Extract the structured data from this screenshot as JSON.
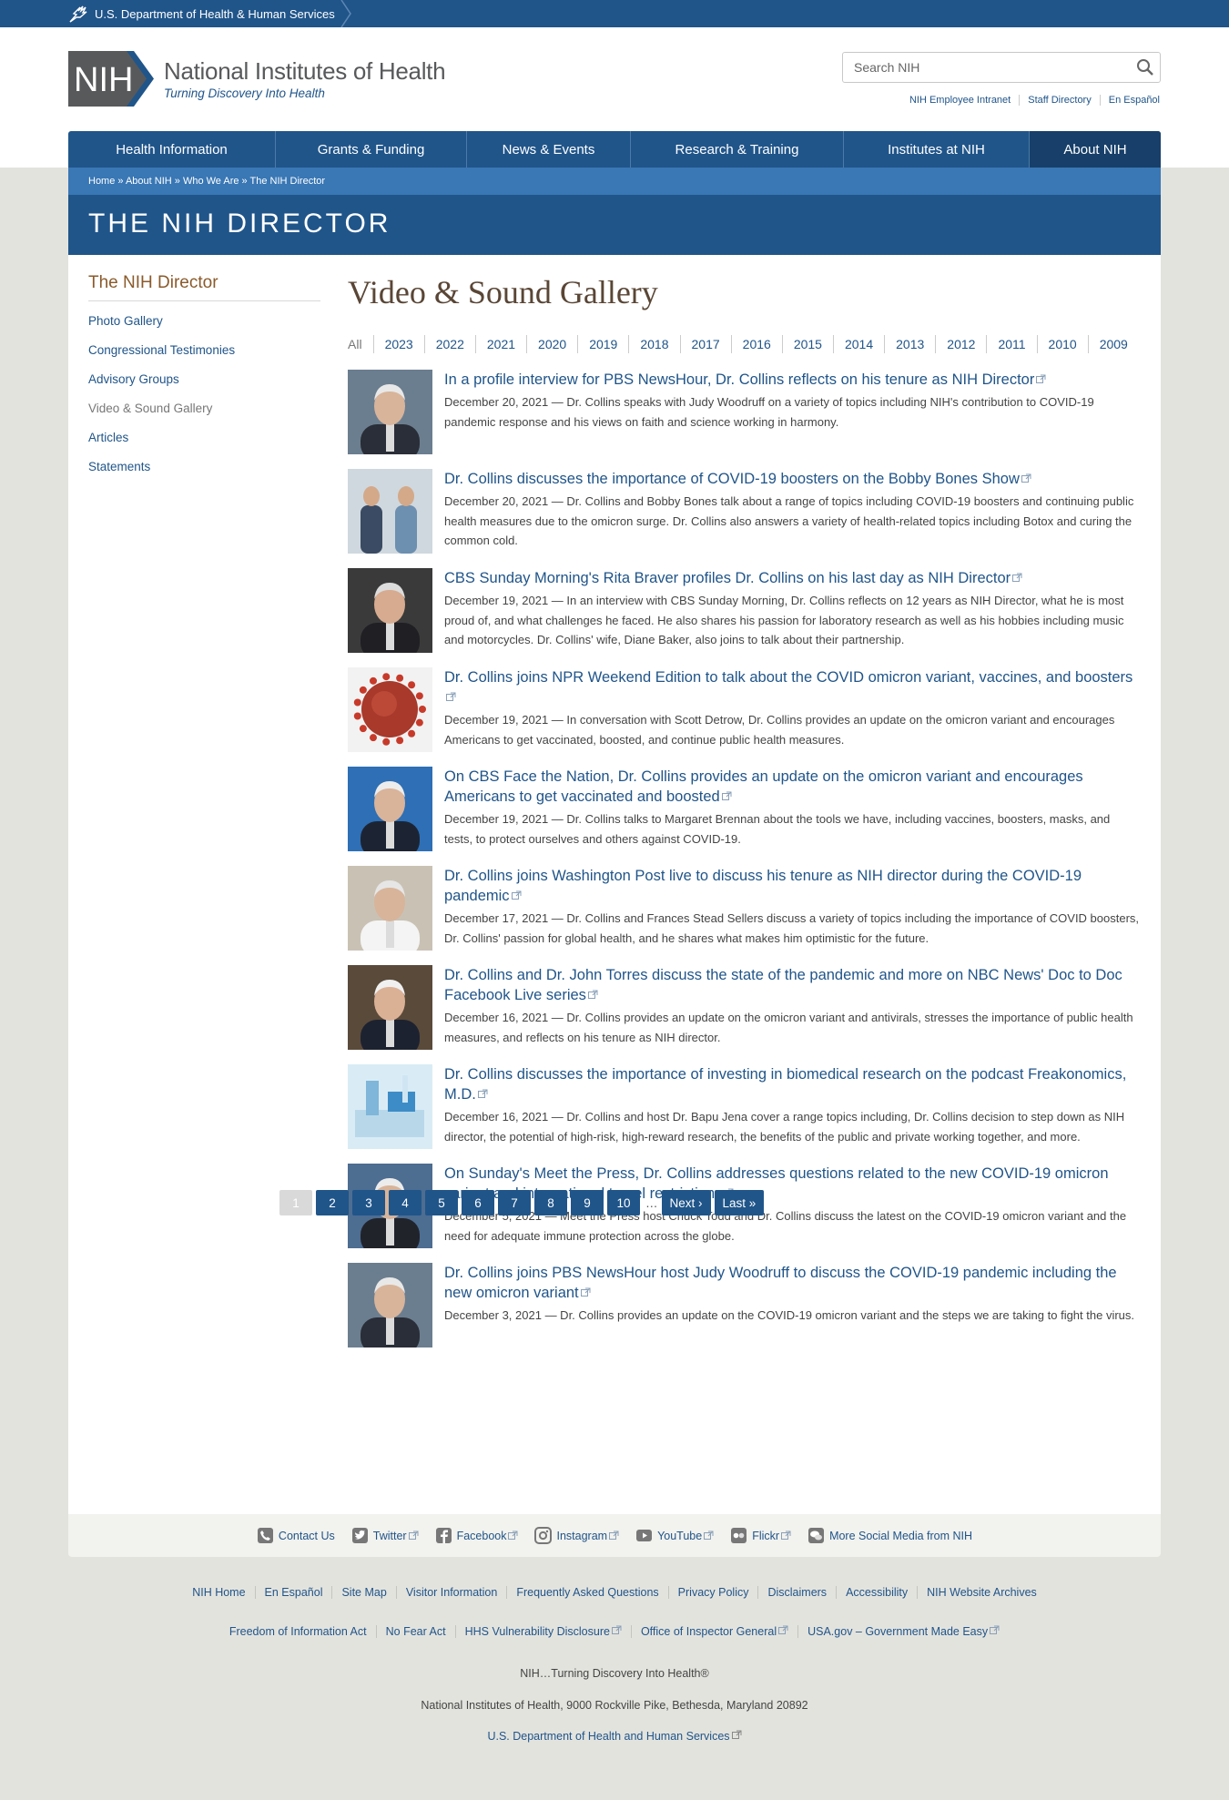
{
  "hhs_bar": {
    "label": "U.S. Department of Health & Human Services"
  },
  "header": {
    "logo_mark": "NIH",
    "logo_title": "National Institutes of Health",
    "logo_tagline": "Turning Discovery Into Health",
    "search_placeholder": "Search NIH",
    "util_links": [
      "NIH Employee Intranet",
      "Staff Directory",
      "En Español"
    ]
  },
  "nav": [
    {
      "label": "Health Information"
    },
    {
      "label": "Grants & Funding"
    },
    {
      "label": "News & Events"
    },
    {
      "label": "Research & Training"
    },
    {
      "label": "Institutes at NIH"
    },
    {
      "label": "About NIH"
    }
  ],
  "breadcrumb": "Home » About NIH » Who We Are » The NIH Director",
  "page_title": "THE NIH DIRECTOR",
  "sidebar": {
    "heading": "The NIH Director",
    "items": [
      {
        "label": "Photo Gallery"
      },
      {
        "label": "Congressional Testimonies"
      },
      {
        "label": "Advisory Groups"
      },
      {
        "label": "Video & Sound Gallery"
      },
      {
        "label": "Articles"
      },
      {
        "label": "Statements"
      }
    ]
  },
  "gallery": {
    "heading": "Video & Sound Gallery",
    "years": [
      "All",
      "2023",
      "2022",
      "2021",
      "2020",
      "2019",
      "2018",
      "2017",
      "2016",
      "2015",
      "2014",
      "2013",
      "2012",
      "2011",
      "2010",
      "2009"
    ],
    "items": [
      {
        "title": "In a profile interview for PBS NewsHour, Dr. Collins reflects on his tenure as NIH Director",
        "desc": "December 20, 2021 — Dr. Collins speaks with Judy Woodruff on a variety of topics including NIH's contribution to COVID-19 pandemic response and his views on faith and science working in harmony."
      },
      {
        "title": "Dr. Collins discusses the importance of COVID-19 boosters on the Bobby Bones Show",
        "desc": "December 20, 2021 — Dr. Collins and Bobby Bones talk about a range of topics including COVID-19 boosters and continuing public health measures due to the omicron surge. Dr. Collins also answers a variety of health-related topics including Botox and curing the common cold."
      },
      {
        "title": "CBS Sunday Morning's Rita Braver profiles Dr. Collins on his last day as NIH Director",
        "desc": "December 19, 2021 — In an interview with CBS Sunday Morning, Dr. Collins reflects on 12 years as NIH Director, what he is most proud of, and what challenges he faced. He also shares his passion for laboratory research as well as his hobbies including music and motorcycles. Dr. Collins' wife, Diane Baker, also joins to talk about their partnership."
      },
      {
        "title": "Dr. Collins joins NPR Weekend Edition to talk about the COVID omicron variant, vaccines, and boosters",
        "desc": "December 19, 2021 — In conversation with Scott Detrow, Dr. Collins provides an update on the omicron variant and encourages Americans to get vaccinated, boosted, and continue public health measures."
      },
      {
        "title": "On CBS Face the Nation, Dr. Collins provides an update on the omicron variant and encourages Americans to get vaccinated and boosted",
        "desc": "December 19, 2021 — Dr. Collins talks to Margaret Brennan about the tools we have, including vaccines, boosters, masks, and tests, to protect ourselves and others against COVID-19."
      },
      {
        "title": "Dr. Collins joins Washington Post live to discuss his tenure as NIH director during the COVID-19 pandemic",
        "desc": "December 17, 2021 — Dr. Collins and Frances Stead Sellers discuss a variety of topics including the importance of COVID boosters, Dr. Collins' passion for global health, and he shares what makes him optimistic for the future."
      },
      {
        "title": "Dr. Collins and Dr. John Torres discuss the state of the pandemic and more on NBC News' Doc to Doc Facebook Live series",
        "desc": "December 16, 2021 — Dr. Collins provides an update on the omicron variant and antivirals, stresses the importance of public health measures, and reflects on his tenure as NIH director."
      },
      {
        "title": "Dr. Collins discusses the importance of investing in biomedical research on the podcast Freakonomics, M.D.",
        "desc": "December 16, 2021 — Dr. Collins and host Dr. Bapu Jena cover a range topics including, Dr. Collins decision to step down as NIH director, the potential of high-risk, high-reward research, the benefits of the public and private working together, and more."
      },
      {
        "title": "On Sunday's Meet the Press, Dr. Collins addresses questions related to the new COVID-19 omicron variant and international travel restrictions",
        "desc": "December 5, 2021 — Meet the Press host Chuck Todd and Dr. Collins discuss the latest on the COVID-19 omicron variant and the need for adequate immune protection across the globe."
      },
      {
        "title": "Dr. Collins joins PBS NewsHour host Judy Woodruff to discuss the COVID-19 pandemic including the new omicron variant",
        "desc": "December 3, 2021 — Dr. Collins provides an update on the COVID-19 omicron variant and the steps we are taking to fight the virus."
      }
    ]
  },
  "pager": {
    "pages": [
      "1",
      "2",
      "3",
      "4",
      "5",
      "6",
      "7",
      "8",
      "9",
      "10"
    ],
    "ellipsis": "…",
    "next": "Next ›",
    "last": "Last »"
  },
  "social": [
    {
      "label": "Contact Us",
      "icon": "phone-icon"
    },
    {
      "label": "Twitter",
      "icon": "twitter-icon"
    },
    {
      "label": "Facebook",
      "icon": "facebook-icon"
    },
    {
      "label": "Instagram",
      "icon": "instagram-icon"
    },
    {
      "label": "YouTube",
      "icon": "youtube-icon"
    },
    {
      "label": "Flickr",
      "icon": "flickr-icon"
    },
    {
      "label": "More Social Media from NIH",
      "icon": "chat-icon"
    }
  ],
  "footer": {
    "row1": [
      "NIH Home",
      "En Español",
      "Site Map",
      "Visitor Information",
      "Frequently Asked Questions",
      "Privacy Policy",
      "Disclaimers",
      "Accessibility",
      "NIH Website Archives"
    ],
    "row2": [
      "Freedom of Information Act",
      "No Fear Act",
      "HHS Vulnerability Disclosure",
      "Office of Inspector General",
      "USA.gov – Government Made Easy"
    ],
    "tagline": "NIH…Turning Discovery Into Health®",
    "address": "National Institutes of Health, 9000 Rockville Pike, Bethesda, Maryland 20892",
    "hhs_link": "U.S. Department of Health and Human Services"
  },
  "colors": {
    "primary_blue": "#20558a",
    "banner_light_blue": "#3977b5",
    "heading_brown": "#5a4636",
    "page_bg": "#e3e3de"
  }
}
